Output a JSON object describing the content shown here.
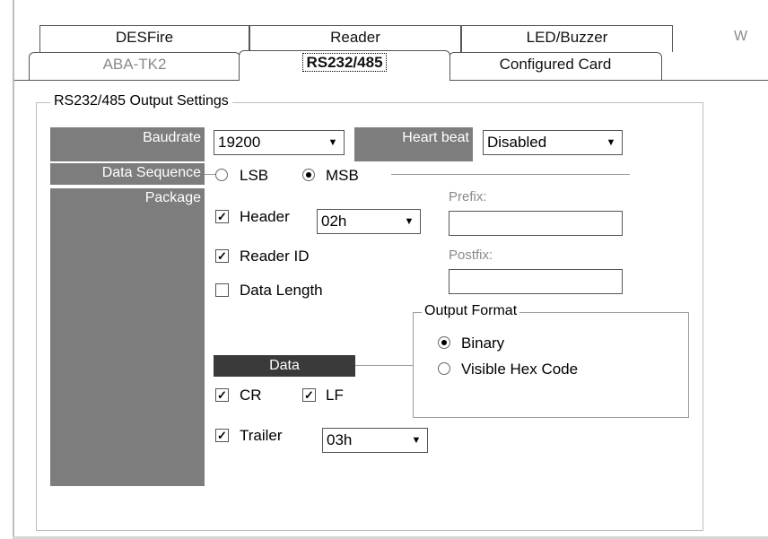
{
  "tabs": {
    "row1": [
      {
        "label": "DESFire"
      },
      {
        "label": "Reader"
      },
      {
        "label": "LED/Buzzer"
      }
    ],
    "overflow_label": "W",
    "row2": [
      {
        "label": "ABA-TK2",
        "state": "disabled"
      },
      {
        "label": "RS232/485",
        "state": "selected"
      },
      {
        "label": "Configured Card",
        "state": "normal"
      }
    ]
  },
  "group": {
    "title": "RS232/485 Output Settings"
  },
  "sidebar": {
    "baudrate": "Baudrate",
    "data_sequence": "Data Sequence",
    "package": "Package",
    "heart_beat": "Heart beat",
    "data": "Data"
  },
  "baudrate": {
    "value": "19200"
  },
  "heart_beat": {
    "value": "Disabled"
  },
  "data_sequence": {
    "options": [
      {
        "label": "LSB",
        "selected": false
      },
      {
        "label": "MSB",
        "selected": true
      }
    ]
  },
  "package": {
    "header": {
      "label": "Header",
      "checked": true,
      "value": "02h"
    },
    "reader_id": {
      "label": "Reader ID",
      "checked": true
    },
    "data_length": {
      "label": "Data Length",
      "checked": false
    },
    "prefix": {
      "label": "Prefix:",
      "value": ""
    },
    "postfix": {
      "label": "Postfix:",
      "value": ""
    }
  },
  "data_opts": {
    "cr": {
      "label": "CR",
      "checked": true
    },
    "lf": {
      "label": "LF",
      "checked": true
    },
    "trailer": {
      "label": "Trailer",
      "checked": true,
      "value": "03h"
    }
  },
  "output_format": {
    "title": "Output Format",
    "options": [
      {
        "label": "Binary",
        "selected": true
      },
      {
        "label": "Visible Hex Code",
        "selected": false
      }
    ]
  },
  "glyphs": {
    "check": "✓",
    "combo_arrow": "▼"
  },
  "colors": {
    "sidebar_gray": "#7d7d7d",
    "data_bar": "#3a3a3a"
  }
}
